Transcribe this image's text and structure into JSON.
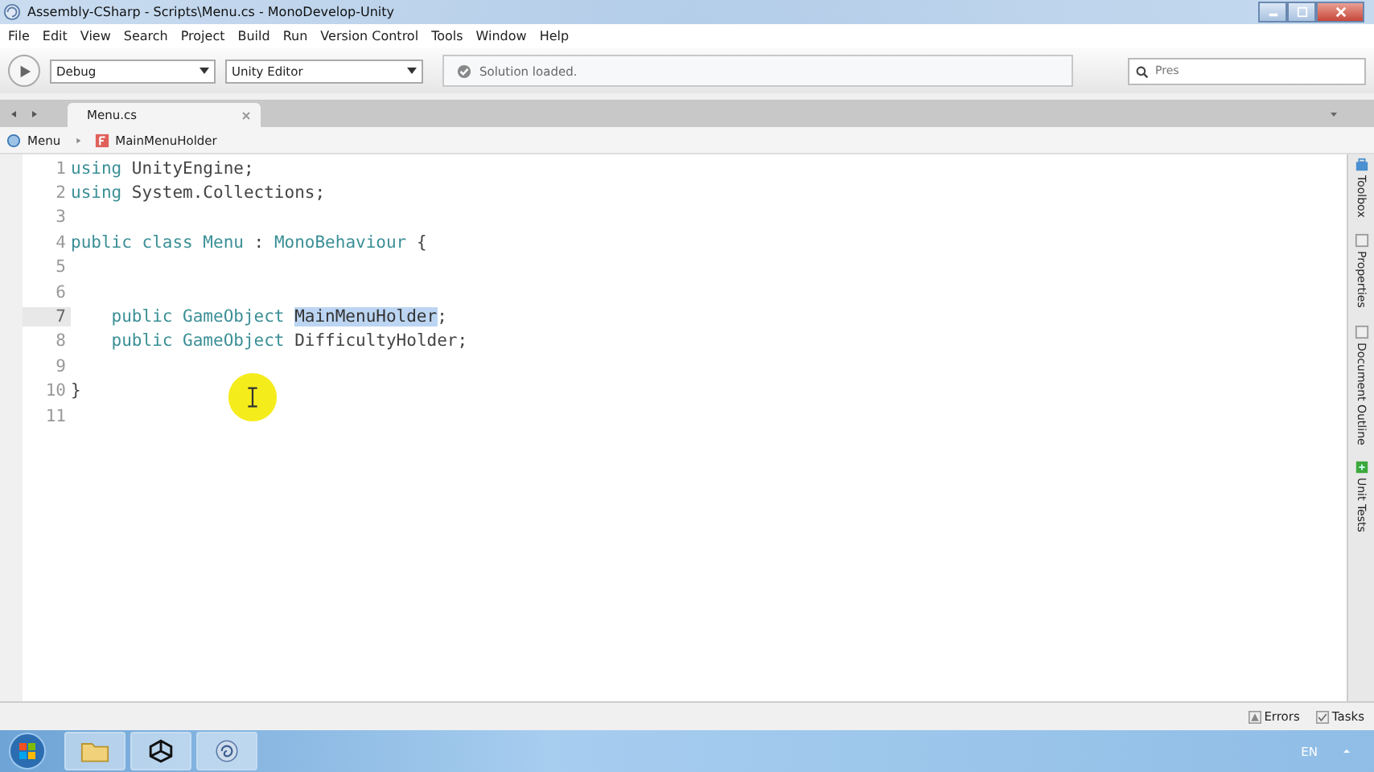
{
  "window": {
    "title": "Assembly-CSharp - Scripts\\Menu.cs - MonoDevelop-Unity"
  },
  "menu": [
    "File",
    "Edit",
    "View",
    "Search",
    "Project",
    "Build",
    "Run",
    "Version Control",
    "Tools",
    "Window",
    "Help"
  ],
  "toolbar": {
    "configuration": "Debug",
    "target": "Unity Editor",
    "status": "Solution loaded.",
    "search": {
      "placeholder": "Pres"
    }
  },
  "tabs": [
    {
      "label": "Menu.cs",
      "selected": true
    }
  ],
  "breadcrumb": [
    "Menu",
    "MainMenuHolder"
  ],
  "editor": {
    "lines": [
      {
        "number": "1",
        "current": false,
        "tokens": [
          {
            "text": "using",
            "kind": "keyword"
          },
          {
            "text": " UnityEngine;",
            "kind": "plain"
          }
        ]
      },
      {
        "number": "2",
        "current": false,
        "tokens": [
          {
            "text": "using",
            "kind": "keyword"
          },
          {
            "text": " System.Collections;",
            "kind": "plain"
          }
        ]
      },
      {
        "number": "3",
        "current": false
      },
      {
        "number": "4",
        "current": false,
        "tokens": [
          {
            "text": "public class",
            "kind": "keyword"
          },
          {
            "text": " Menu",
            "kind": "type"
          },
          {
            "text": " :",
            "kind": "plain"
          },
          {
            "text": " MonoBehaviour",
            "kind": "type"
          },
          {
            "text": " {",
            "kind": "plain"
          }
        ]
      },
      {
        "number": "5",
        "current": false
      },
      {
        "number": "6",
        "current": false
      },
      {
        "number": "7",
        "current": true,
        "tokens": [
          {
            "text": "    public",
            "kind": "keyword"
          },
          {
            "text": " GameObject",
            "kind": "type"
          },
          {
            "text": "MainMenuHolder",
            "kind": "selected"
          },
          {
            "text": ";",
            "kind": "plain"
          }
        ]
      },
      {
        "number": "8",
        "current": false,
        "tokens": [
          {
            "text": "    public",
            "kind": "keyword"
          },
          {
            "text": " GameObject",
            "kind": "type"
          },
          {
            "text": " DifficultyHolder;",
            "kind": "plain"
          }
        ]
      },
      {
        "number": "9",
        "current": false
      },
      {
        "number": "10",
        "current": false,
        "tokens": [
          {
            "text": "}",
            "kind": "plain"
          }
        ]
      },
      {
        "number": "11",
        "current": false
      }
    ]
  },
  "dock": [
    "Toolbox",
    "Properties",
    "Document Outline",
    "Unit Tests"
  ],
  "status_bar": [
    "Errors",
    "Tasks"
  ],
  "taskbar": {
    "language": "EN"
  }
}
